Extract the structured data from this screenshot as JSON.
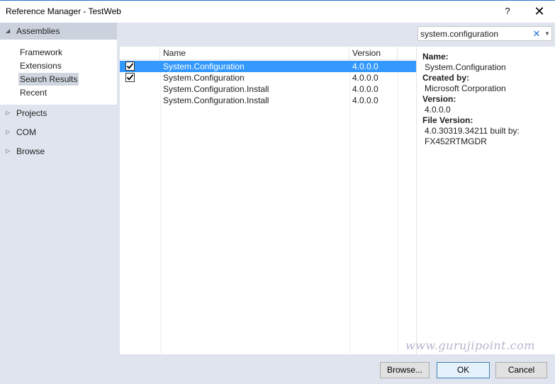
{
  "window": {
    "title": "Reference Manager - TestWeb",
    "help_label": "?",
    "close_label": "✕"
  },
  "nav": {
    "groups": [
      {
        "label": "Assemblies",
        "expanded": true,
        "arrow": "◢"
      },
      {
        "label": "Projects",
        "expanded": false,
        "arrow": "▷"
      },
      {
        "label": "COM",
        "expanded": false,
        "arrow": "▷"
      },
      {
        "label": "Browse",
        "expanded": false,
        "arrow": "▷"
      }
    ],
    "sub_items": [
      "Framework",
      "Extensions",
      "Search Results",
      "Recent"
    ],
    "selected_sub_item": "Search Results"
  },
  "search": {
    "value": "system.configuration",
    "clear_label": "✕",
    "dropdown_label": "▼"
  },
  "list": {
    "columns": [
      "Name",
      "Version"
    ],
    "rows": [
      {
        "name": "System.Configuration",
        "version": "4.0.0.0",
        "checked": true,
        "selected": true
      },
      {
        "name": "System.Configuration",
        "version": "4.0.0.0",
        "checked": true,
        "selected": false
      },
      {
        "name": "System.Configuration.Install",
        "version": "4.0.0.0",
        "checked": false,
        "selected": false
      },
      {
        "name": "System.Configuration.Install",
        "version": "4.0.0.0",
        "checked": false,
        "selected": false
      }
    ]
  },
  "details": {
    "name_label": "Name:",
    "name_value": "System.Configuration",
    "created_label": "Created by:",
    "created_value": "Microsoft Corporation",
    "version_label": "Version:",
    "version_value": "4.0.0.0",
    "file_version_label": "File Version:",
    "file_version_value_1": "4.0.30319.34211 built by:",
    "file_version_value_2": "FX452RTMGDR"
  },
  "watermark": "www.gurujipoint.com",
  "buttons": {
    "browse": "Browse...",
    "ok": "OK",
    "cancel": "Cancel"
  },
  "colors": {
    "accent": "#3399ff",
    "panel_bg": "#dfe4ee",
    "link_x": "#1e6fd8"
  }
}
